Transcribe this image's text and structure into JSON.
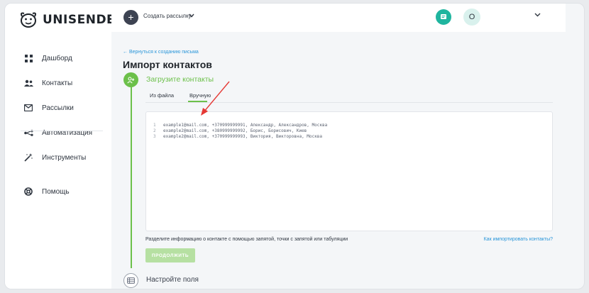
{
  "app": {
    "logo_text": "UNISENDER"
  },
  "sidebar": {
    "items": [
      {
        "label": "Дашборд",
        "icon": "dashboard-grid-icon"
      },
      {
        "label": "Контакты",
        "icon": "contacts-people-icon"
      },
      {
        "label": "Рассылки",
        "icon": "mail-icon"
      },
      {
        "label": "Автоматизация",
        "icon": "automation-icon"
      },
      {
        "label": "Инструменты",
        "icon": "magic-wand-icon"
      },
      {
        "label": "Помощь",
        "icon": "help-lifebuoy-icon"
      }
    ]
  },
  "topbar": {
    "plus_label": "+",
    "create_label": "Создать рассылку",
    "chevron": "⌄",
    "avatar_initial": "О",
    "menu_chevron": "⌄"
  },
  "main": {
    "back_link": "← Вернуться к созданию письма",
    "title": "Импорт контактов",
    "step1": {
      "title": "Загрузите контакты",
      "tabs": [
        {
          "label": "Из файла",
          "active": false
        },
        {
          "label": "Вручную",
          "active": true
        }
      ]
    },
    "editor_lines": [
      {
        "num": "1",
        "text": "example1@mail.com, +370999999991, Александр, Александров, Москва"
      },
      {
        "num": "2",
        "text": "example2@mail.com, +380999999992, Борис, Борисович, Киев"
      },
      {
        "num": "3",
        "text": "example2@mail.com, +370999999993, Виктория, Викторовна, Москва"
      }
    ],
    "hint": "Разделите информацию о контакте с помощью запятой, точки с запятой или табуляции",
    "help_link": "Как импортировать контакты?",
    "continue_button": "ПРОДОЛЖИТЬ",
    "step2": {
      "title": "Настройте поля"
    }
  },
  "colors": {
    "accent_green": "#6cc04a",
    "link_blue": "#2a96d9",
    "teal": "#1fb59f",
    "annotation_red": "#e53935"
  }
}
